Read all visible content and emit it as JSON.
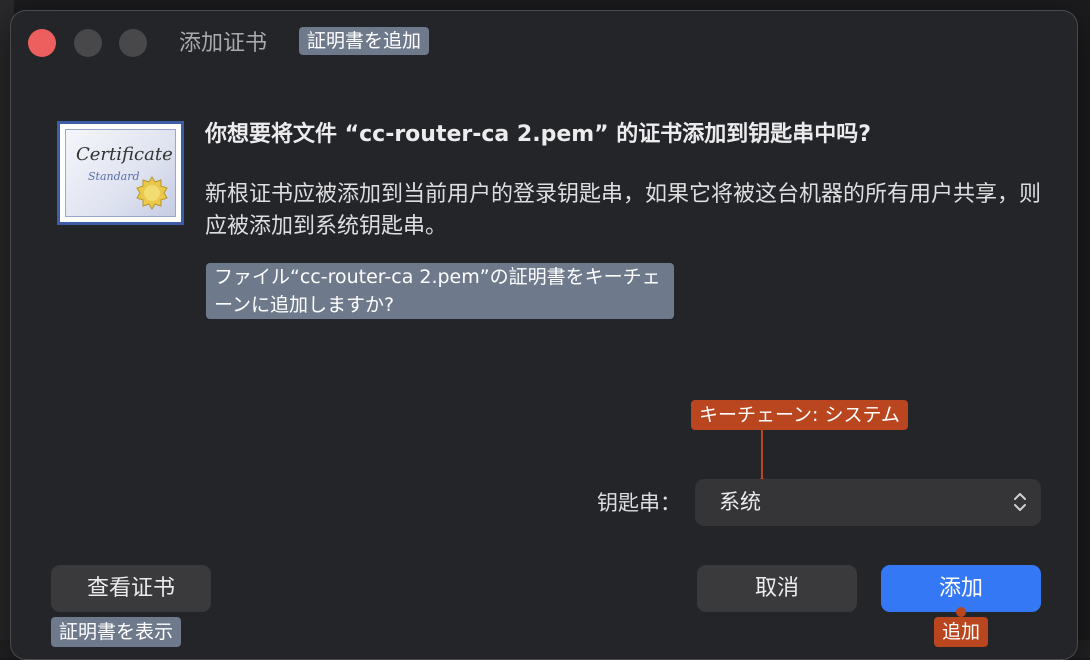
{
  "window": {
    "title": "添加证书",
    "title_jp": "証明書を追加"
  },
  "icon": {
    "name": "certificate-icon",
    "text": "Certificate",
    "subtext": "Standard"
  },
  "dialog": {
    "question": "你想要将文件 “cc-router-ca 2.pem” 的证书添加到钥匙串中吗?",
    "description": "新根证书应被添加到当前用户的登录钥匙串，如果它将被这台机器的所有用户共享，则应被添加到系统钥匙串。",
    "question_jp": "ファイル“cc-router-ca 2.pem”の証明書をキーチェーンに追加しますか?"
  },
  "keychain": {
    "label": "钥匙串：",
    "selected": "系统",
    "annotation_jp": "キーチェーン: システム"
  },
  "buttons": {
    "view": "查看证书",
    "view_jp": "証明書を表示",
    "cancel": "取消",
    "add": "添加",
    "add_jp": "追加"
  },
  "colors": {
    "accent": "#3478f6",
    "annotation": "#b9461f",
    "jp_label": "#6e7a8c",
    "close": "#ec5f5e"
  }
}
